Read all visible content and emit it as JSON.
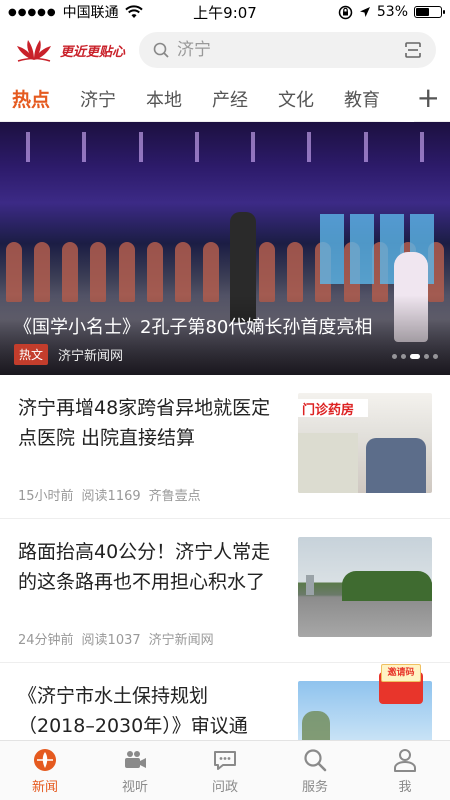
{
  "status_bar": {
    "carrier": "中国联通",
    "time": "上午9:07",
    "battery": "53%",
    "battery_level": 0.53
  },
  "header": {
    "logo_text": "更近更贴心",
    "search_placeholder": "济宁"
  },
  "tabs": [
    "热点",
    "济宁",
    "本地",
    "产经",
    "文化",
    "教育"
  ],
  "active_tab": 0,
  "banner": {
    "title": "《国学小名士》2孔子第80代嫡长孙首度亮相",
    "tag": "热文",
    "source": "济宁新闻网"
  },
  "articles": [
    {
      "title": "济宁再增48家跨省异地就医定点医院 出院直接结算",
      "time": "15小时前",
      "reads": "阅读1169",
      "source": "齐鲁壹点",
      "thumb_sign": "门诊药房"
    },
    {
      "title": "路面抬高40公分！济宁人常走的这条路再也不用担心积水了",
      "time": "24分钟前",
      "reads": "阅读1037",
      "source": "济宁新闻网"
    },
    {
      "title": "《济宁市水土保持规划（2018–2030年）》审议通"
    }
  ],
  "invite_label": "邀请码",
  "tabbar": [
    {
      "label": "新闻",
      "icon": "news-icon"
    },
    {
      "label": "视听",
      "icon": "camera-icon"
    },
    {
      "label": "问政",
      "icon": "chat-icon"
    },
    {
      "label": "服务",
      "icon": "search-icon"
    },
    {
      "label": "我",
      "icon": "person-icon"
    }
  ],
  "colors": {
    "accent": "#e55a1f",
    "brand_red": "#c9212a",
    "tag_red": "#c33d2c"
  }
}
